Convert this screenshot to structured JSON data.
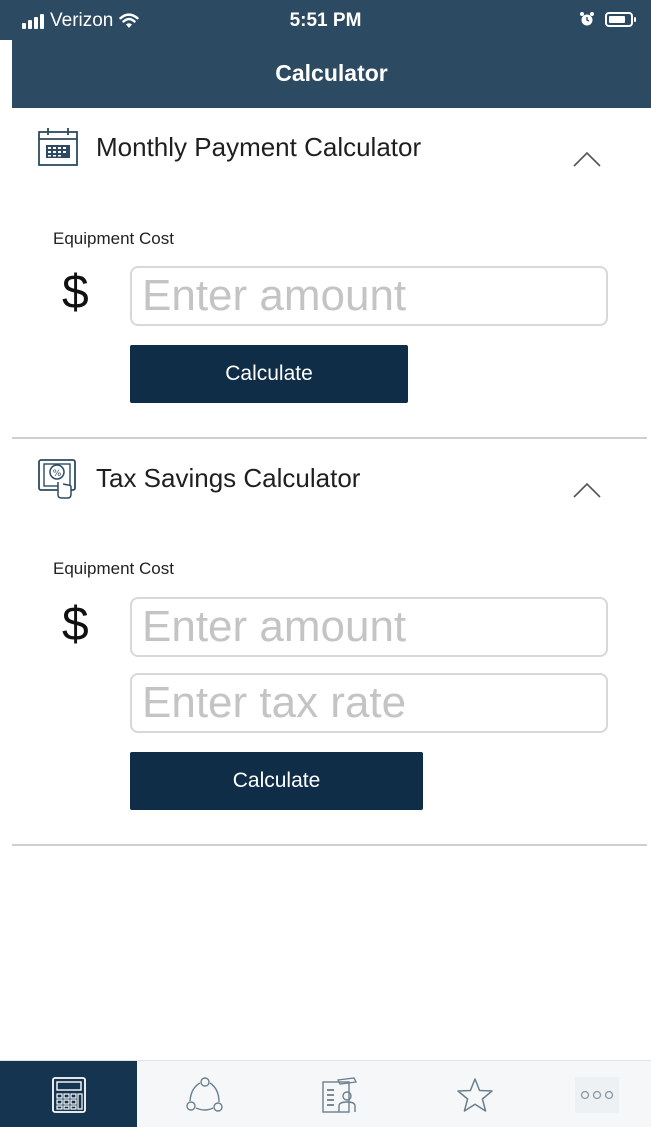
{
  "status_bar": {
    "carrier": "Verizon",
    "time": "5:51 PM"
  },
  "nav": {
    "title": "Calculator"
  },
  "monthly_calculator": {
    "title": "Monthly Payment Calculator",
    "icon": "calendar-icon",
    "field_label": "Equipment Cost",
    "currency_symbol": "$",
    "amount_placeholder": "Enter amount",
    "calculate_label": "Calculate"
  },
  "tax_calculator": {
    "title": "Tax Savings Calculator",
    "icon": "tax-percent-icon",
    "field_label": "Equipment Cost",
    "currency_symbol": "$",
    "amount_placeholder": "Enter amount",
    "tax_rate_placeholder": "Enter tax rate",
    "calculate_label": "Calculate"
  },
  "tab_bar": {
    "tabs": [
      {
        "icon": "calculator-icon",
        "active": true
      },
      {
        "icon": "share-cycle-icon",
        "active": false
      },
      {
        "icon": "document-person-icon",
        "active": false
      },
      {
        "icon": "star-icon",
        "active": false
      },
      {
        "icon": "more-icon",
        "active": false
      }
    ]
  },
  "colors": {
    "header": "#2c4a61",
    "button": "#0f2d47",
    "active_tab": "#14344f"
  }
}
